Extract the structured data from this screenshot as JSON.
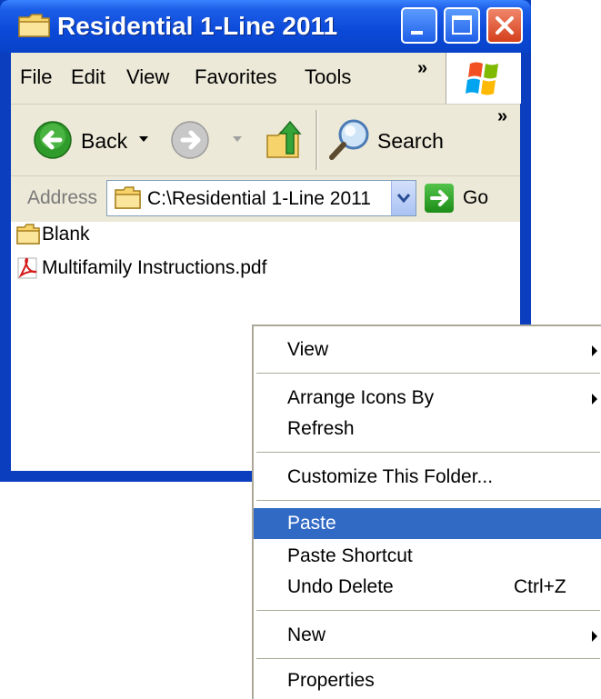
{
  "window": {
    "title": "Residential 1-Line 2011",
    "colors": {
      "titlebar": "#0a49d8",
      "close": "#d4401c",
      "selection": "#316ac5"
    },
    "icons": {
      "title": "folder-icon",
      "minimize": "minimize-icon",
      "maximize": "maximize-icon",
      "close": "close-icon"
    }
  },
  "menubar": {
    "items": [
      "File",
      "Edit",
      "View",
      "Favorites",
      "Tools"
    ],
    "overflow": "»"
  },
  "toolbar": {
    "back_label": "Back",
    "search_label": "Search",
    "overflow": "»",
    "icons": {
      "back": "back-arrow-icon",
      "forward": "forward-arrow-icon",
      "up": "folder-up-icon",
      "search": "search-icon"
    }
  },
  "address": {
    "label": "Address",
    "value": "C:\\Residential 1-Line 2011",
    "go_label": "Go"
  },
  "files": [
    {
      "name": "Blank",
      "icon": "folder-icon"
    },
    {
      "name": "Multifamily Instructions.pdf",
      "icon": "pdf-icon"
    }
  ],
  "context_menu": {
    "items": [
      {
        "label": "View",
        "submenu": true
      },
      {
        "label": "Arrange Icons By",
        "submenu": true
      },
      {
        "label": "Refresh"
      },
      {
        "label": "Customize This Folder..."
      },
      {
        "label": "Paste",
        "highlighted": true
      },
      {
        "label": "Paste Shortcut"
      },
      {
        "label": "Undo Delete",
        "shortcut": "Ctrl+Z"
      },
      {
        "label": "New",
        "submenu": true
      },
      {
        "label": "Properties"
      }
    ]
  }
}
